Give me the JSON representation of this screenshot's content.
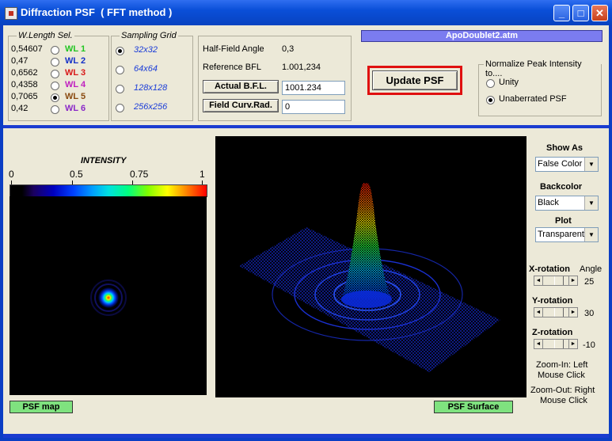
{
  "window": {
    "title": "Diffraction PSF  ( FFT method )"
  },
  "wavelengths": {
    "legend": "W.Length Sel.",
    "items": [
      {
        "value": "0,54607",
        "label": "WL  1",
        "color": "#21c521",
        "selected": false
      },
      {
        "value": "0,47",
        "label": "WL  2",
        "color": "#1430c8",
        "selected": false
      },
      {
        "value": "0,6562",
        "label": "WL  3",
        "color": "#d81818",
        "selected": false
      },
      {
        "value": "0,4358",
        "label": "WL  4",
        "color": "#c020c0",
        "selected": false
      },
      {
        "value": "0,7065",
        "label": "WL  5",
        "color": "#8a4a10",
        "selected": true
      },
      {
        "value": "0,42",
        "label": "WL  6",
        "color": "#8a28c8",
        "selected": false
      }
    ]
  },
  "sampling": {
    "legend": "Sampling Grid",
    "items": [
      {
        "label": "32x32",
        "selected": true
      },
      {
        "label": "64x64",
        "selected": false
      },
      {
        "label": "128x128",
        "selected": false
      },
      {
        "label": "256x256",
        "selected": false
      }
    ]
  },
  "params": {
    "half_field_label": "Half-Field Angle",
    "half_field_value": "0,3",
    "ref_bfl_label": "Reference BFL",
    "ref_bfl_value": "1.001,234",
    "actual_bfl_button": "Actual  B.F.L.",
    "actual_bfl_value": "1001.234",
    "field_curv_button": "Field Curv.Rad.",
    "field_curv_value": "0"
  },
  "file_name": "ApoDoublet2.atm",
  "update_button": "Update PSF",
  "normalize": {
    "legend": "Normalize Peak Intensity to....",
    "options": [
      {
        "label": "Unity",
        "selected": false
      },
      {
        "label": "Unaberrated PSF",
        "selected": true
      }
    ]
  },
  "intensity_scale": {
    "title": "INTENSITY",
    "ticks": [
      "0",
      "0.5",
      "0.75",
      "1"
    ]
  },
  "controls": {
    "show_as_label": "Show As",
    "show_as_value": "False Color",
    "backcolor_label": "Backcolor",
    "backcolor_value": "Black",
    "plot_label": "Plot",
    "plot_value": "Transparent",
    "x_rot_label": "X-rotation",
    "angle_label": "Angle",
    "x_rot_value": "25",
    "y_rot_label": "Y-rotation",
    "y_rot_value": "30",
    "z_rot_label": "Z-rotation",
    "z_rot_value": "-10",
    "zoom_in_text_1": "Zoom-In: Left",
    "zoom_in_text_2": "Mouse  Click",
    "zoom_out_text_1": "Zoom-Out: Right",
    "zoom_out_text_2": "Mouse  Click"
  },
  "psf_map_label": "PSF map",
  "psf_surface_label": "PSF Surface",
  "colors": {
    "accent": "#1a3cd0",
    "file_bar": "#7b7cf0",
    "label_green": "#7fe27f",
    "update_border": "#e01010"
  }
}
